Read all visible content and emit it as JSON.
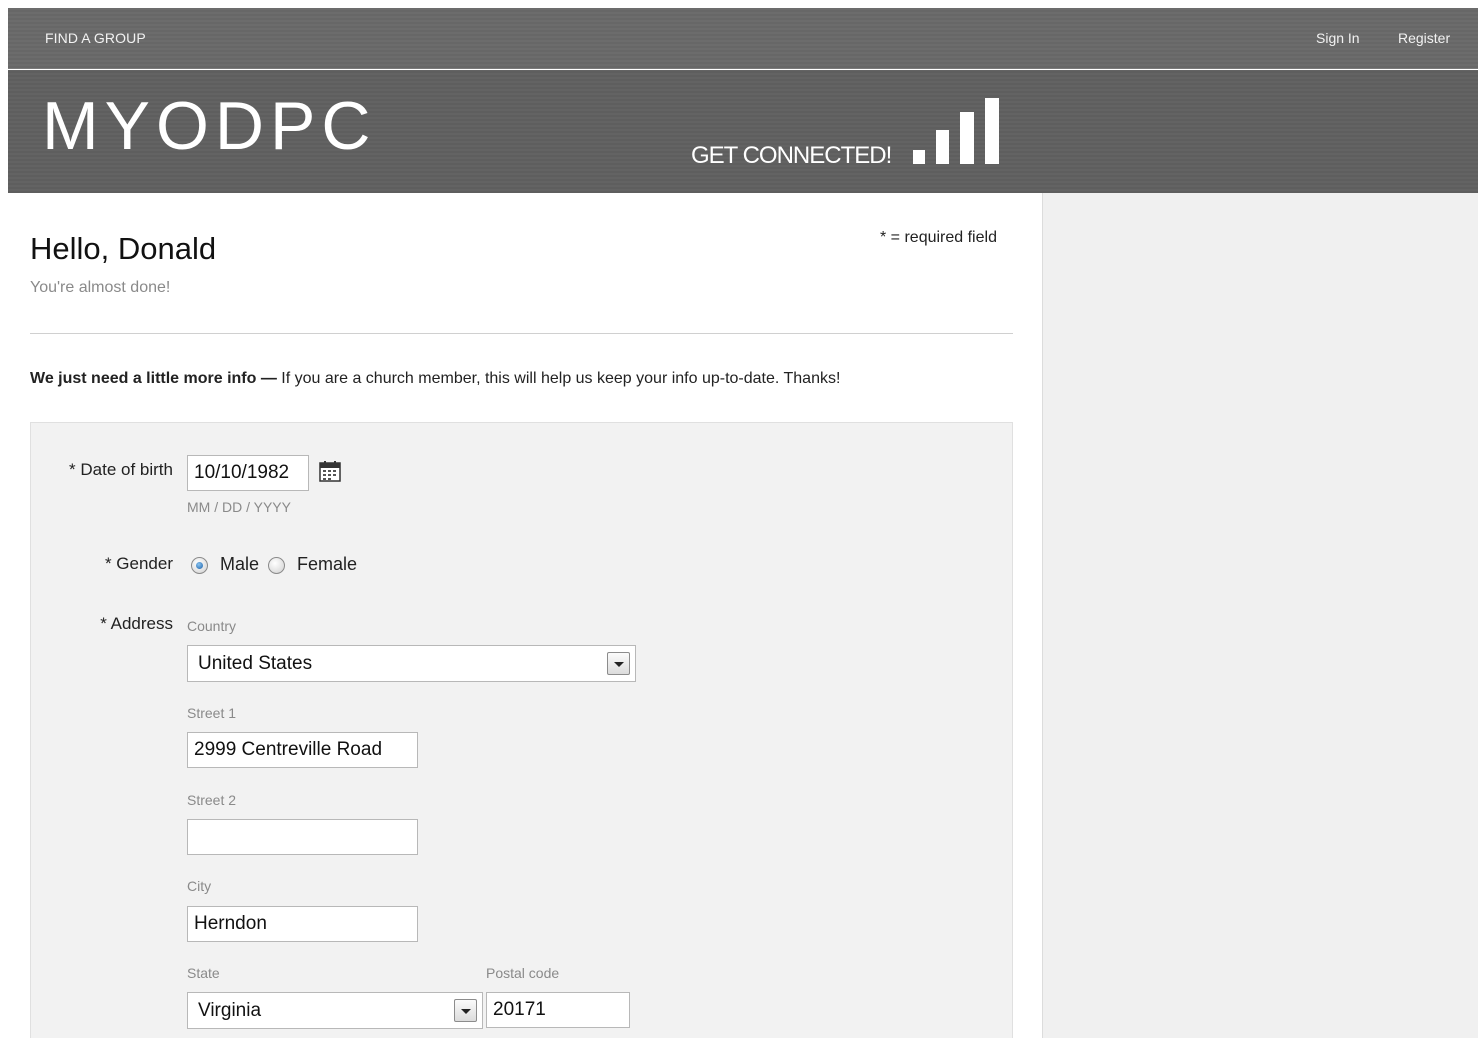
{
  "nav": {
    "find_group": "FIND A GROUP",
    "sign_in": "Sign In",
    "register": "Register"
  },
  "banner": {
    "logo": "MYODPC",
    "tagline": "GET CONNECTED!"
  },
  "page": {
    "greeting": "Hello, Donald",
    "subtitle": "You're almost done!",
    "required_note": "* = required field",
    "intro_bold": "We just need a little more info —",
    "intro_text": " If you are a church member, this will help us keep your info up-to-date. Thanks!"
  },
  "form": {
    "dob": {
      "label": "* Date of birth",
      "value": "10/10/1982",
      "hint": "MM / DD / YYYY"
    },
    "gender": {
      "label": "* Gender",
      "options": [
        {
          "label": "Male",
          "selected": true
        },
        {
          "label": "Female",
          "selected": false
        }
      ]
    },
    "address": {
      "label": "* Address",
      "country_label": "Country",
      "country_value": "United States",
      "street1_label": "Street 1",
      "street1_value": "2999 Centreville Road",
      "street2_label": "Street 2",
      "street2_value": "",
      "city_label": "City",
      "city_value": "Herndon",
      "state_label": "State",
      "state_value": "Virginia",
      "postal_label": "Postal code",
      "postal_value": "20171"
    }
  },
  "icons": {
    "calendar": "calendar-icon",
    "signal": "signal-bars-icon"
  }
}
